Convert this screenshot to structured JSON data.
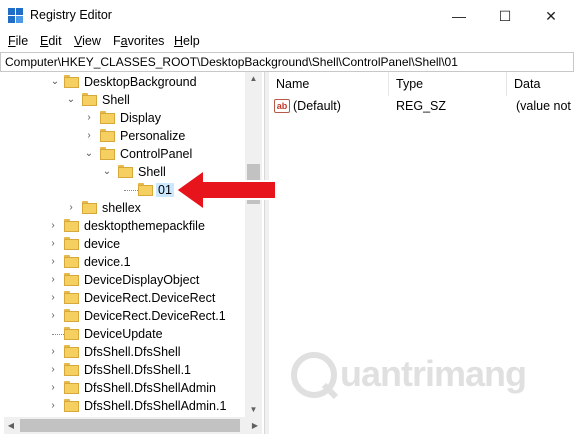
{
  "window": {
    "title": "Registry Editor",
    "minimize": "—",
    "maximize": "☐",
    "close": "✕"
  },
  "menu": [
    {
      "accel": "F",
      "rest": "ile"
    },
    {
      "accel": "E",
      "rest": "dit"
    },
    {
      "accel": "V",
      "rest": "iew"
    },
    {
      "accel": "",
      "rest": "Favorites",
      "accel_index": "a"
    },
    {
      "accel": "H",
      "rest": "elp"
    }
  ],
  "menu_labels": {
    "favorites_pre": "F",
    "favorites_accel": "a",
    "favorites_post": "vorites"
  },
  "address": "Computer\\HKEY_CLASSES_ROOT\\DesktopBackground\\Shell\\ControlPanel\\Shell\\01",
  "tree": [
    {
      "label": "DesktopBackground",
      "twisty": "⌄"
    },
    {
      "label": "Shell",
      "twisty": "⌄"
    },
    {
      "label": "Display",
      "twisty": "›"
    },
    {
      "label": "Personalize",
      "twisty": "›"
    },
    {
      "label": "ControlPanel",
      "twisty": "⌄"
    },
    {
      "label": "Shell",
      "twisty": "⌄"
    },
    {
      "label": "01",
      "twisty": ""
    },
    {
      "label": "shellex",
      "twisty": "›"
    },
    {
      "label": "desktopthemepackfile",
      "twisty": "›"
    },
    {
      "label": "device",
      "twisty": "›"
    },
    {
      "label": "device.1",
      "twisty": "›"
    },
    {
      "label": "DeviceDisplayObject",
      "twisty": "›"
    },
    {
      "label": "DeviceRect.DeviceRect",
      "twisty": "›"
    },
    {
      "label": "DeviceRect.DeviceRect.1",
      "twisty": "›"
    },
    {
      "label": "DeviceUpdate",
      "twisty": ""
    },
    {
      "label": "DfsShell.DfsShell",
      "twisty": "›"
    },
    {
      "label": "DfsShell.DfsShell.1",
      "twisty": "›"
    },
    {
      "label": "DfsShell.DfsShellAdmin",
      "twisty": "›"
    },
    {
      "label": "DfsShell.DfsShellAdmin.1",
      "twisty": "›"
    }
  ],
  "columns": {
    "name": "Name",
    "type": "Type",
    "data": "Data"
  },
  "values": [
    {
      "icon": "ab",
      "name": "(Default)",
      "type": "REG_SZ",
      "data": "(value not"
    }
  ],
  "scroll": {
    "up": "▲",
    "down": "▼",
    "left": "◀",
    "right": "▶"
  },
  "watermark": "uantrimang",
  "colors": {
    "arrow": "#e8141c",
    "selection": "#cce8ff",
    "folder": "#f5cf5f",
    "accent": "#1f6fc8"
  }
}
